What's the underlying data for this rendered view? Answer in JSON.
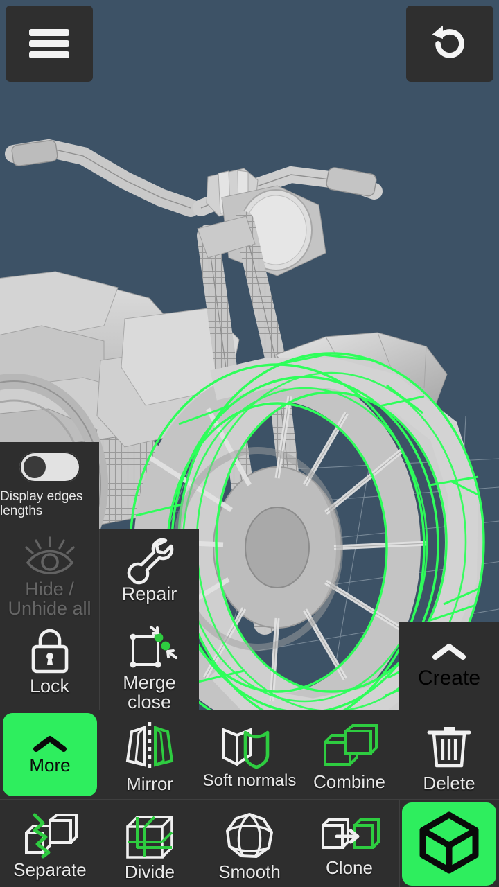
{
  "app": {
    "background_color": "#3d5266",
    "panel_color": "#2e2e2e",
    "accent_color": "#2eee5e",
    "text_color": "#e8e8e8"
  },
  "topbar": {
    "menu_button": {
      "icon": "hamburger-menu-icon",
      "label": ""
    },
    "undo_button": {
      "icon": "undo-arrow-icon",
      "label": ""
    }
  },
  "viewport": {
    "scene_description": "Low-poly 3D motorcycle model in grey shaded wireframe on slate-blue background",
    "selection": {
      "object": "front wheel",
      "highlight_color": "#2eff5a"
    },
    "grid_visible": true
  },
  "edge_length_panel": {
    "toggle": {
      "name": "display-edges-lengths-toggle",
      "state": "off"
    },
    "label": "Display edges lengths"
  },
  "mid_tools": [
    {
      "label": "Hide / Unhide all",
      "icon": "eye-icon",
      "enabled": false
    },
    {
      "label": "Repair",
      "icon": "wrench-icon",
      "enabled": true
    },
    {
      "label": "Lock",
      "icon": "padlock-icon",
      "enabled": true
    },
    {
      "label": "Merge close vertices",
      "icon": "merge-vertices-icon",
      "enabled": true
    }
  ],
  "create_panel": {
    "label": "Create",
    "icon": "chevron-up-icon"
  },
  "bottom_toolbar": {
    "row1": [
      {
        "label": "More",
        "icon": "chevron-up-icon",
        "highlighted": true
      },
      {
        "label": "Mirror",
        "icon": "mirror-icon",
        "highlighted": false
      },
      {
        "label": "Soft normals",
        "icon": "soft-normals-icon",
        "highlighted": false
      },
      {
        "label": "Combine",
        "icon": "combine-icon",
        "highlighted": false
      },
      {
        "label": "Delete",
        "icon": "trash-icon",
        "highlighted": false
      }
    ],
    "row2": [
      {
        "label": "Separate",
        "icon": "separate-icon",
        "highlighted": false
      },
      {
        "label": "Divide",
        "icon": "divide-icon",
        "highlighted": false
      },
      {
        "label": "Smooth",
        "icon": "smooth-sphere-icon",
        "highlighted": false
      },
      {
        "label": "Clone",
        "icon": "clone-icon",
        "highlighted": false
      },
      {
        "label": "",
        "icon": "cube-icon",
        "highlighted": true
      }
    ]
  }
}
